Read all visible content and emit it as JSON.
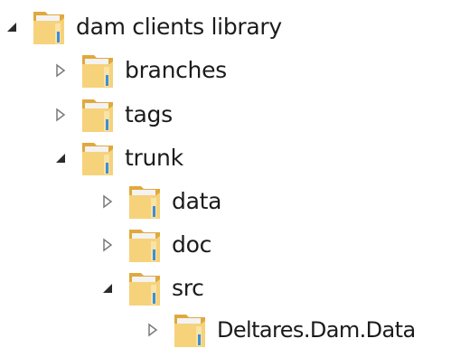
{
  "tree": {
    "items": [
      {
        "label": "dam clients library",
        "expanded": true
      },
      {
        "label": "branches",
        "expanded": false
      },
      {
        "label": "tags",
        "expanded": false
      },
      {
        "label": "trunk",
        "expanded": true
      },
      {
        "label": "data",
        "expanded": false
      },
      {
        "label": "doc",
        "expanded": false
      },
      {
        "label": "src",
        "expanded": true
      },
      {
        "label": "Deltares.Dam.Data",
        "expanded": false
      }
    ],
    "icons": {
      "expanded": "triangle-down-right-icon",
      "collapsed": "triangle-right-outline-icon",
      "node": "folder-icon"
    }
  },
  "colors": {
    "text": "#1b1b1b",
    "folder_back": "#e0a93c",
    "folder_front": "#f6d27a",
    "folder_paper": "#f3f3f3",
    "folder_accent": "#3a8fd8",
    "expander_filled": "#2b2b2b",
    "expander_outline": "#7a7a7a"
  }
}
